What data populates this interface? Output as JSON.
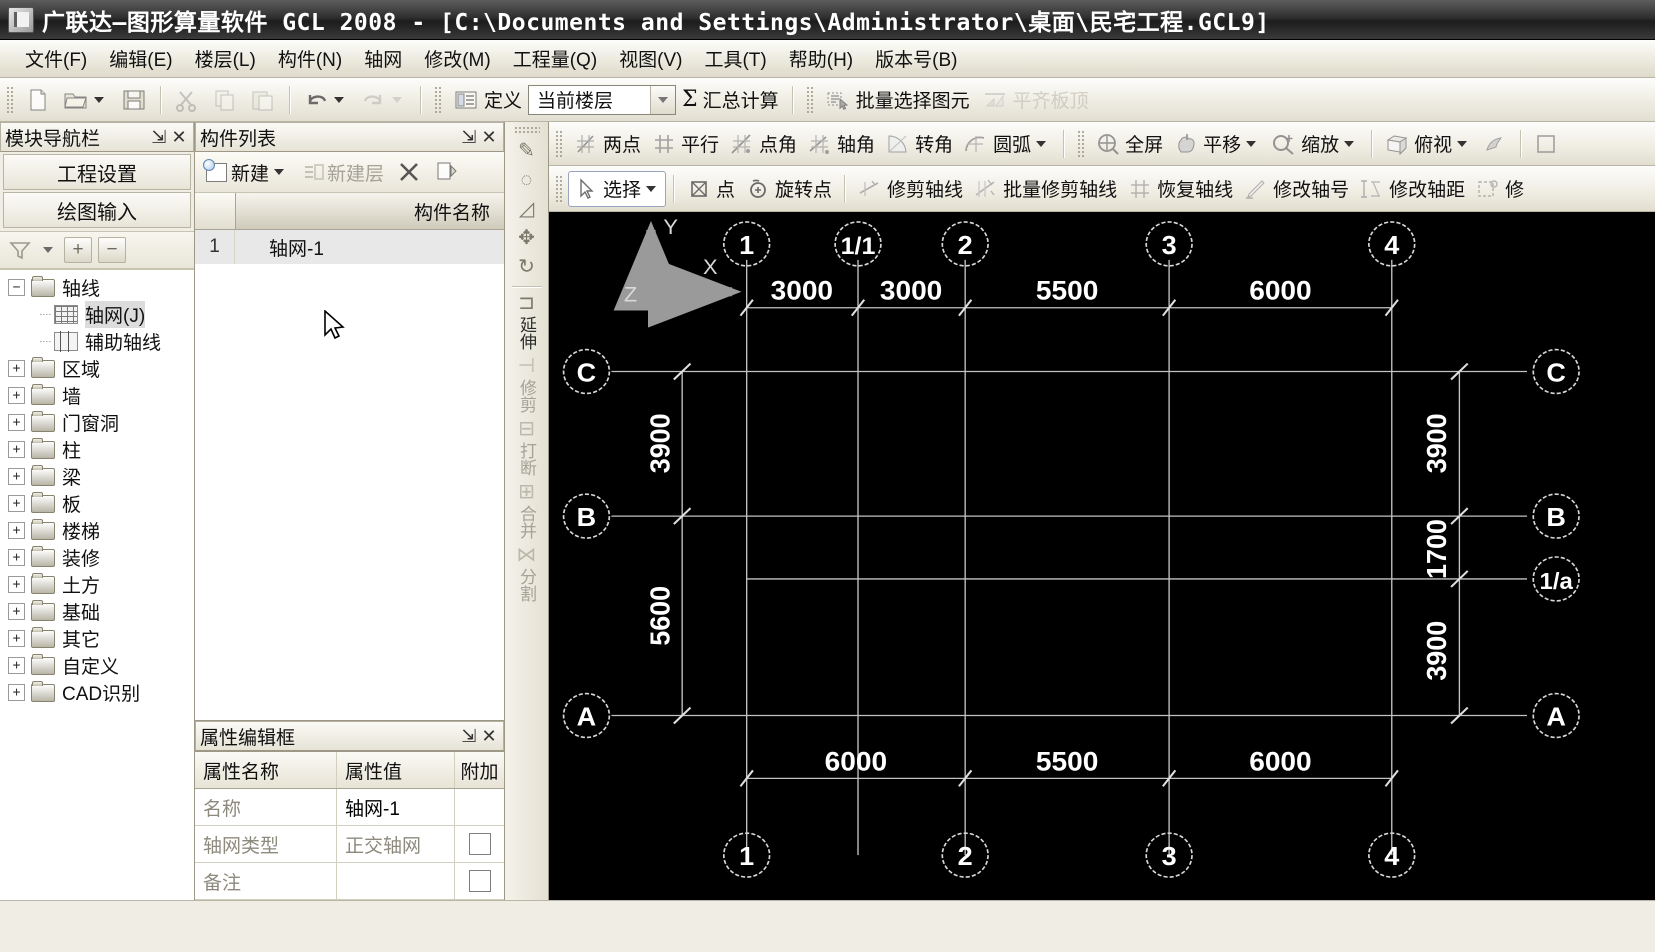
{
  "window": {
    "title": "广联达—图形算量软件 GCL 2008 - [C:\\Documents and Settings\\Administrator\\桌面\\民宅工程.GCL9]",
    "icon": "app-icon"
  },
  "menubar": {
    "items": [
      {
        "label": "文件(F)"
      },
      {
        "label": "编辑(E)"
      },
      {
        "label": "楼层(L)"
      },
      {
        "label": "构件(N)"
      },
      {
        "label": "轴网"
      },
      {
        "label": "修改(M)"
      },
      {
        "label": "工程量(Q)"
      },
      {
        "label": "视图(V)"
      },
      {
        "label": "工具(T)"
      },
      {
        "label": "帮助(H)"
      },
      {
        "label": "版本号(B)"
      }
    ]
  },
  "toolbar": {
    "new_icon": "new-file-icon",
    "open_icon": "open-folder-icon",
    "save_icon": "save-disk-icon",
    "cut_icon": "scissors-icon",
    "copy_icon": "copy-icon",
    "paste_icon": "paste-icon",
    "undo_icon": "undo-arrow-icon",
    "redo_icon": "redo-arrow-icon",
    "define_label": "定义",
    "define_icon": "define-icon",
    "floor_combo_value": "当前楼层",
    "sum_label": "汇总计算",
    "sum_icon": "sigma-icon",
    "batch_select_label": "批量选择图元",
    "batch_select_icon": "batch-select-icon",
    "flush_slab_label": "平齐板顶",
    "flush_slab_icon": "flush-slab-icon"
  },
  "nav_panel": {
    "caption": "模块导航栏",
    "pin_icon": "pin-icon",
    "close_icon": "close-icon",
    "buttons": [
      {
        "label": "工程设置"
      },
      {
        "label": "绘图输入"
      }
    ],
    "tools": {
      "filter_icon": "filter-icon",
      "dropdown_icon": "chevron-down-icon",
      "expand_icon": "plus-icon",
      "collapse_icon": "minus-icon"
    },
    "tree": [
      {
        "label": "轴线",
        "expander": "−",
        "icon": "folder-open-icon",
        "level": 0,
        "selected": false
      },
      {
        "label": "轴网(J)",
        "expander": "",
        "icon": "grid-icon",
        "level": 1,
        "selected": true
      },
      {
        "label": "辅助轴线",
        "expander": "",
        "icon": "aux-axis-icon",
        "level": 1,
        "selected": false
      },
      {
        "label": "区域",
        "expander": "+",
        "icon": "folder-icon",
        "level": 0,
        "selected": false
      },
      {
        "label": "墙",
        "expander": "+",
        "icon": "folder-icon",
        "level": 0,
        "selected": false
      },
      {
        "label": "门窗洞",
        "expander": "+",
        "icon": "folder-icon",
        "level": 0,
        "selected": false
      },
      {
        "label": "柱",
        "expander": "+",
        "icon": "folder-icon",
        "level": 0,
        "selected": false
      },
      {
        "label": "梁",
        "expander": "+",
        "icon": "folder-icon",
        "level": 0,
        "selected": false
      },
      {
        "label": "板",
        "expander": "+",
        "icon": "folder-icon",
        "level": 0,
        "selected": false
      },
      {
        "label": "楼梯",
        "expander": "+",
        "icon": "folder-icon",
        "level": 0,
        "selected": false
      },
      {
        "label": "装修",
        "expander": "+",
        "icon": "folder-icon",
        "level": 0,
        "selected": false
      },
      {
        "label": "土方",
        "expander": "+",
        "icon": "folder-icon",
        "level": 0,
        "selected": false
      },
      {
        "label": "基础",
        "expander": "+",
        "icon": "folder-icon",
        "level": 0,
        "selected": false
      },
      {
        "label": "其它",
        "expander": "+",
        "icon": "folder-icon",
        "level": 0,
        "selected": false
      },
      {
        "label": "自定义",
        "expander": "+",
        "icon": "folder-icon",
        "level": 0,
        "selected": false
      },
      {
        "label": "CAD识别",
        "expander": "+",
        "icon": "folder-icon",
        "level": 0,
        "selected": false
      }
    ]
  },
  "component_list": {
    "caption": "构件列表",
    "pin_icon": "pin-icon",
    "close_icon": "close-icon",
    "tools": [
      {
        "label": "新建",
        "icon": "new-component-icon",
        "dropdown": true,
        "enabled": true
      },
      {
        "label": "新建层",
        "icon": "new-layer-icon",
        "dropdown": false,
        "enabled": false
      },
      {
        "label": "",
        "icon": "delete-x-icon",
        "dropdown": false,
        "enabled": true
      },
      {
        "label": "",
        "icon": "copy-component-icon",
        "dropdown": false,
        "enabled": true
      }
    ],
    "columns": [
      "",
      "构件名称"
    ],
    "rows": [
      {
        "num": "1",
        "name": "轴网-1"
      }
    ]
  },
  "property_panel": {
    "caption": "属性编辑框",
    "pin_icon": "pin-icon",
    "close_icon": "close-icon",
    "columns": [
      "属性名称",
      "属性值",
      "附加"
    ],
    "rows": [
      {
        "name": "名称",
        "value": "轴网-1",
        "gray_name": true,
        "gray_value": false,
        "checkbox": false
      },
      {
        "name": "轴网类型",
        "value": "正交轴网",
        "gray_name": true,
        "gray_value": true,
        "checkbox": true
      },
      {
        "name": "备注",
        "value": "",
        "gray_name": true,
        "gray_value": false,
        "checkbox": true
      }
    ]
  },
  "vertical_toolbar": {
    "grip_icon": "drag-grip-icon",
    "items": [
      {
        "label": "",
        "icon": "pen-draw-icon",
        "enabled": true
      },
      {
        "label": "",
        "icon": "offset-icon",
        "enabled": true
      },
      {
        "label": "",
        "icon": "mirror-icon",
        "enabled": true
      },
      {
        "label": "",
        "icon": "move-icon",
        "enabled": true
      },
      {
        "label": "",
        "icon": "rotate-icon",
        "enabled": true
      },
      {
        "label": "延伸",
        "icon": "extend-icon",
        "enabled": true
      },
      {
        "label": "修剪",
        "icon": "trim-icon",
        "enabled": false
      },
      {
        "label": "打断",
        "icon": "break-icon",
        "enabled": false
      },
      {
        "label": "合并",
        "icon": "merge-icon",
        "enabled": false
      },
      {
        "label": "分割",
        "icon": "split-icon",
        "enabled": false
      }
    ]
  },
  "cad_toolbar_row1": [
    {
      "label": "两点",
      "icon": "two-point-icon",
      "dropdown": false,
      "group": 1
    },
    {
      "label": "平行",
      "icon": "parallel-icon",
      "dropdown": false,
      "group": 1
    },
    {
      "label": "点角",
      "icon": "point-angle-icon",
      "dropdown": false,
      "group": 1
    },
    {
      "label": "轴角",
      "icon": "axis-angle-icon",
      "dropdown": false,
      "group": 1
    },
    {
      "label": "转角",
      "icon": "corner-angle-icon",
      "dropdown": false,
      "group": 1
    },
    {
      "label": "圆弧",
      "icon": "arc-icon",
      "dropdown": true,
      "group": 1
    },
    {
      "label": "全屏",
      "icon": "fullscreen-icon",
      "dropdown": false,
      "group": 2
    },
    {
      "label": "平移",
      "icon": "pan-icon",
      "dropdown": true,
      "group": 2
    },
    {
      "label": "缩放",
      "icon": "zoom-icon",
      "dropdown": true,
      "group": 2
    },
    {
      "label": "俯视",
      "icon": "top-view-icon",
      "dropdown": true,
      "group": 3
    },
    {
      "label": "",
      "icon": "animate-icon",
      "dropdown": false,
      "group": 3
    }
  ],
  "cad_toolbar_row2": [
    {
      "label": "选择",
      "icon": "select-arrow-icon",
      "dropdown": true,
      "active": true,
      "group": 1
    },
    {
      "label": "点",
      "icon": "point-icon",
      "dropdown": false,
      "active": false,
      "group": 2
    },
    {
      "label": "旋转点",
      "icon": "rotate-point-icon",
      "dropdown": false,
      "active": false,
      "group": 2
    },
    {
      "label": "修剪轴线",
      "icon": "trim-axis-icon",
      "dropdown": false,
      "active": false,
      "group": 3
    },
    {
      "label": "批量修剪轴线",
      "icon": "batch-trim-axis-icon",
      "dropdown": false,
      "active": false,
      "group": 3
    },
    {
      "label": "恢复轴线",
      "icon": "restore-axis-icon",
      "dropdown": false,
      "active": false,
      "group": 3
    },
    {
      "label": "修改轴号",
      "icon": "edit-axis-number-icon",
      "dropdown": false,
      "active": false,
      "group": 3
    },
    {
      "label": "修改轴距",
      "icon": "edit-axis-spacing-icon",
      "dropdown": false,
      "active": false,
      "group": 3
    },
    {
      "label": "修",
      "icon": "edit-more-icon",
      "dropdown": false,
      "active": false,
      "group": 3
    }
  ],
  "canvas": {
    "background": "#000000",
    "line_color": "#c8c8c8",
    "text_color": "#ffffff",
    "axis_gizmo": {
      "x": "X",
      "y": "Y",
      "z": "Z"
    },
    "grid": {
      "vertical_axes_top": [
        "1",
        "1/1",
        "2",
        "3",
        "4"
      ],
      "vertical_axes_bottom": [
        "1",
        "2",
        "3",
        "4"
      ],
      "horizontal_axes_left": [
        "C",
        "B",
        "A"
      ],
      "horizontal_axes_right": [
        "C",
        "B",
        "1/a",
        "A"
      ],
      "top_dimensions": [
        "3000",
        "3000",
        "5500",
        "6000"
      ],
      "bottom_dimensions": [
        "6000",
        "5500",
        "6000"
      ],
      "left_dimensions": [
        "3900",
        "5600"
      ],
      "right_dimensions": [
        "3900",
        "1700",
        "3900"
      ]
    }
  }
}
